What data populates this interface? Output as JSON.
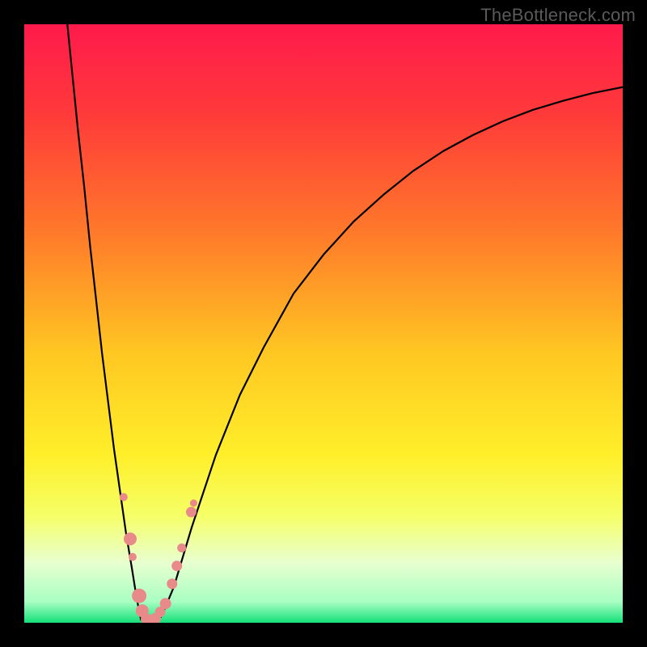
{
  "watermark": {
    "text": "TheBottleneck.com"
  },
  "chart_data": {
    "type": "line",
    "title": "",
    "xlabel": "",
    "ylabel": "",
    "xlim": [
      0,
      100
    ],
    "ylim": [
      0,
      100
    ],
    "grid": false,
    "legend": false,
    "gradient_stops": [
      {
        "pos": 0.0,
        "color": "#ff1a4c"
      },
      {
        "pos": 0.15,
        "color": "#ff3a3a"
      },
      {
        "pos": 0.35,
        "color": "#ff7a2a"
      },
      {
        "pos": 0.55,
        "color": "#ffc722"
      },
      {
        "pos": 0.72,
        "color": "#ffef2a"
      },
      {
        "pos": 0.82,
        "color": "#f6ff66"
      },
      {
        "pos": 0.9,
        "color": "#e8ffd0"
      },
      {
        "pos": 0.965,
        "color": "#a8ffc2"
      },
      {
        "pos": 1.0,
        "color": "#15e07a"
      }
    ],
    "series": [
      {
        "name": "left-descent",
        "x": [
          7.0,
          8.0,
          9.0,
          10.0,
          11.0,
          12.0,
          13.0,
          14.0,
          15.0,
          16.0,
          17.0,
          18.0,
          18.8,
          19.5
        ],
        "y": [
          102.0,
          92.0,
          82.0,
          73.0,
          63.0,
          54.0,
          45.0,
          37.0,
          29.0,
          22.0,
          15.0,
          9.0,
          4.0,
          0.5
        ]
      },
      {
        "name": "valley",
        "x": [
          19.5,
          20.0,
          20.5,
          21.0,
          21.5,
          22.0,
          22.5,
          23.0
        ],
        "y": [
          0.5,
          0.1,
          0.0,
          0.0,
          0.05,
          0.2,
          0.6,
          1.2
        ]
      },
      {
        "name": "right-ascent",
        "x": [
          23.0,
          25.0,
          28.0,
          32.0,
          36.0,
          40.0,
          45.0,
          50.0,
          55.0,
          60.0,
          65.0,
          70.0,
          75.0,
          80.0,
          85.0,
          90.0,
          95.0,
          100.0
        ],
        "y": [
          1.2,
          6.0,
          16.0,
          28.0,
          38.0,
          46.0,
          55.0,
          61.5,
          67.0,
          71.5,
          75.5,
          78.8,
          81.5,
          83.8,
          85.7,
          87.2,
          88.5,
          89.5
        ]
      }
    ],
    "markers": {
      "name": "highlight-dots",
      "color": "#e98a8a",
      "points": [
        {
          "x": 16.6,
          "y": 21.0,
          "r": 5.0
        },
        {
          "x": 17.7,
          "y": 14.0,
          "r": 8.0
        },
        {
          "x": 18.1,
          "y": 11.0,
          "r": 5.0
        },
        {
          "x": 19.2,
          "y": 4.5,
          "r": 9.0
        },
        {
          "x": 19.7,
          "y": 2.0,
          "r": 8.0
        },
        {
          "x": 20.4,
          "y": 0.6,
          "r": 7.0
        },
        {
          "x": 21.1,
          "y": 0.3,
          "r": 7.0
        },
        {
          "x": 21.9,
          "y": 0.7,
          "r": 7.0
        },
        {
          "x": 22.7,
          "y": 1.8,
          "r": 6.5
        },
        {
          "x": 23.6,
          "y": 3.2,
          "r": 7.0
        },
        {
          "x": 24.7,
          "y": 6.5,
          "r": 6.5
        },
        {
          "x": 25.5,
          "y": 9.5,
          "r": 6.5
        },
        {
          "x": 26.3,
          "y": 12.5,
          "r": 5.5
        },
        {
          "x": 27.9,
          "y": 18.5,
          "r": 6.5
        },
        {
          "x": 28.3,
          "y": 20.0,
          "r": 4.5
        }
      ]
    }
  }
}
